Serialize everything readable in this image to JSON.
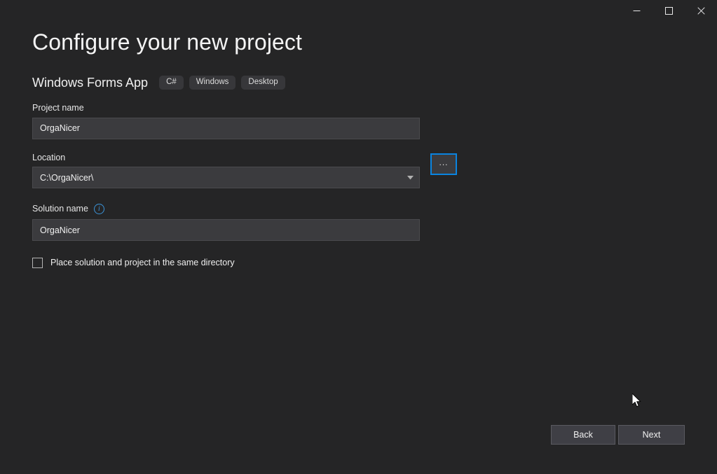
{
  "window": {
    "controls": [
      {
        "name": "minimize",
        "glyph": "minimize-icon"
      },
      {
        "name": "maximize",
        "glyph": "maximize-icon"
      },
      {
        "name": "close",
        "glyph": "close-icon"
      }
    ]
  },
  "header": {
    "title": "Configure your new project",
    "template_name": "Windows Forms App",
    "tags": [
      "C#",
      "Windows",
      "Desktop"
    ]
  },
  "form": {
    "project_name": {
      "label": "Project name",
      "value": "OrgaNicer",
      "placeholder": ""
    },
    "location": {
      "label": "Location",
      "value": "C:\\OrgaNicer\\",
      "placeholder": "",
      "browse_label": "..."
    },
    "solution_name": {
      "label": "Solution name",
      "info_glyph": "i",
      "value": "OrgaNicer",
      "placeholder": ""
    },
    "same_directory": {
      "label": "Place solution and project in the same directory",
      "checked": false
    }
  },
  "footer": {
    "back_label": "Back",
    "next_label": "Next"
  },
  "colors": {
    "background": "#252526",
    "field_background": "#3b3b3e",
    "field_border": "#4a4a4d",
    "accent_blue": "#0a84e0",
    "info_blue": "#3b94d9",
    "pill_background": "#37373a",
    "button_background": "#3f3f45"
  }
}
